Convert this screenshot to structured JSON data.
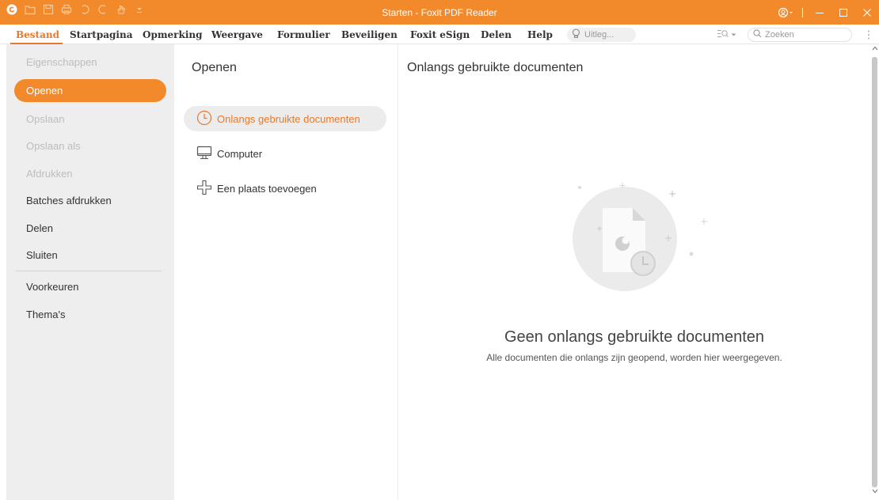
{
  "window": {
    "title": "Starten - Foxit PDF Reader"
  },
  "quick_access": {
    "icons": [
      "foxit-logo-icon",
      "open-icon",
      "save-icon",
      "print-icon",
      "undo-icon",
      "redo-icon",
      "hand-tool-icon",
      "customize-icon"
    ]
  },
  "menu": {
    "items": [
      {
        "label": "Bestand",
        "active": true
      },
      {
        "label": "Startpagina"
      },
      {
        "label": "Opmerking"
      },
      {
        "label": "Weergave"
      },
      {
        "label": "Formulier"
      },
      {
        "label": "Beveiligen"
      },
      {
        "label": "Foxit eSign"
      },
      {
        "label": "Delen"
      },
      {
        "label": "Help"
      }
    ],
    "tell_me_placeholder": "Uitleg...",
    "search_placeholder": "Zoeken"
  },
  "sidebar": {
    "items": [
      {
        "label": "Eigenschappen",
        "state": "disabled"
      },
      {
        "label": "Openen",
        "state": "selected"
      },
      {
        "label": "Opslaan",
        "state": "disabled"
      },
      {
        "label": "Opslaan als",
        "state": "disabled"
      },
      {
        "label": "Afdrukken",
        "state": "disabled"
      },
      {
        "label": "Batches afdrukken",
        "state": "normal"
      },
      {
        "label": "Delen",
        "state": "normal"
      },
      {
        "label": "Sluiten",
        "state": "normal"
      },
      {
        "label": "Voorkeuren",
        "state": "normal"
      },
      {
        "label": "Thema's",
        "state": "normal"
      }
    ]
  },
  "open_panel": {
    "title": "Openen",
    "locations": [
      {
        "label": "Onlangs gebruikte documenten",
        "icon": "clock-icon",
        "selected": true
      },
      {
        "label": "Computer",
        "icon": "computer-icon"
      },
      {
        "label": "Een plaats toevoegen",
        "icon": "add-place-icon"
      }
    ]
  },
  "recent": {
    "title": "Onlangs gebruikte documenten",
    "empty_title": "Geen onlangs gebruikte documenten",
    "empty_desc": "Alle documenten die onlangs zijn geopend, worden hier weergegeven."
  },
  "colors": {
    "accent": "#f28a2b",
    "sidebar_bg": "#eeeeee"
  }
}
